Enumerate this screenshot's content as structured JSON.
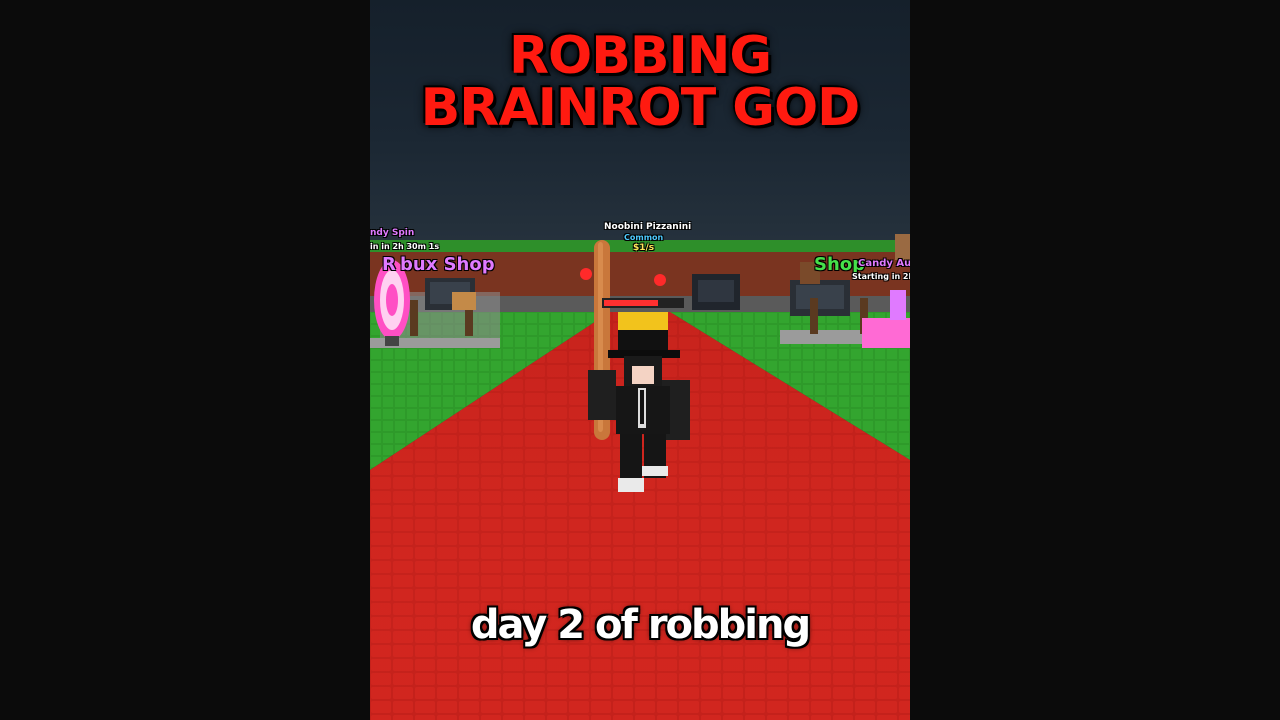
{
  "title": {
    "line1": "ROBBING",
    "line2": "BRAINROT GOD"
  },
  "caption": "day 2 of robbing",
  "world_labels": {
    "candy_spin": "ndy Spin",
    "candy_spin_timer": "in in 2h 30m 1s",
    "robux_shop": "bux Shop",
    "robux_shop_prefix": "R",
    "shop_right": "Shop",
    "candy_auction": "Candy Au",
    "candy_auction_timer": "Starting in 2h"
  },
  "pet_tag": {
    "name": "Noobini Pizzanini",
    "rarity": "Common",
    "rate": "$1/s"
  },
  "colors": {
    "title": "#ff1a10",
    "caption": "#ffffff",
    "grass": "#2e9a2a",
    "carpet": "#c4211b",
    "wall": "#7a3420",
    "sky": "#1b2733"
  }
}
